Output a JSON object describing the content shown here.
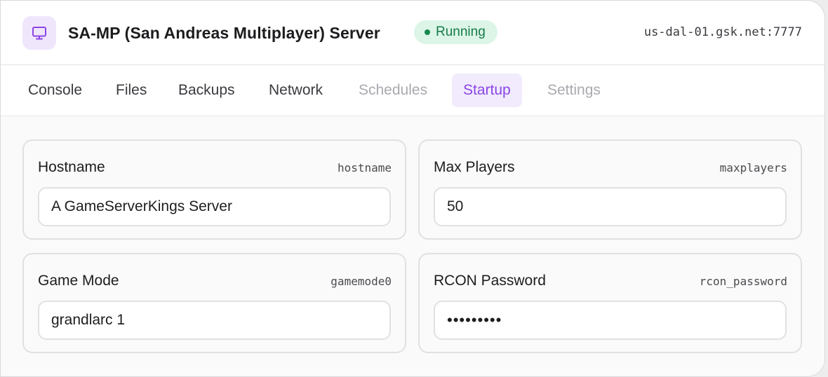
{
  "server": {
    "title": "SA-MP (San Andreas Multiplayer) Server",
    "status": "Running",
    "address": "us-dal-01.gsk.net:7777",
    "icon": "monitor-icon"
  },
  "colors": {
    "accent": "#8b45e6",
    "accent_bg": "#f1ebfd",
    "status_bg": "#dcf5e7",
    "status_text": "#177a46"
  },
  "tabs": [
    {
      "label": "Console",
      "state": "normal"
    },
    {
      "label": "Files",
      "state": "normal"
    },
    {
      "label": "Backups",
      "state": "normal"
    },
    {
      "label": "Network",
      "state": "normal"
    },
    {
      "label": "Schedules",
      "state": "disabled"
    },
    {
      "label": "Startup",
      "state": "active"
    },
    {
      "label": "Settings",
      "state": "disabled"
    }
  ],
  "variables": [
    {
      "label": "Hostname",
      "key": "hostname",
      "value": "A GameServerKings Server"
    },
    {
      "label": "Max Players",
      "key": "maxplayers",
      "value": "50"
    },
    {
      "label": "Game Mode",
      "key": "gamemode0",
      "value": "grandlarc 1"
    },
    {
      "label": "RCON Password",
      "key": "rcon_password",
      "value": "•••••••••"
    }
  ]
}
